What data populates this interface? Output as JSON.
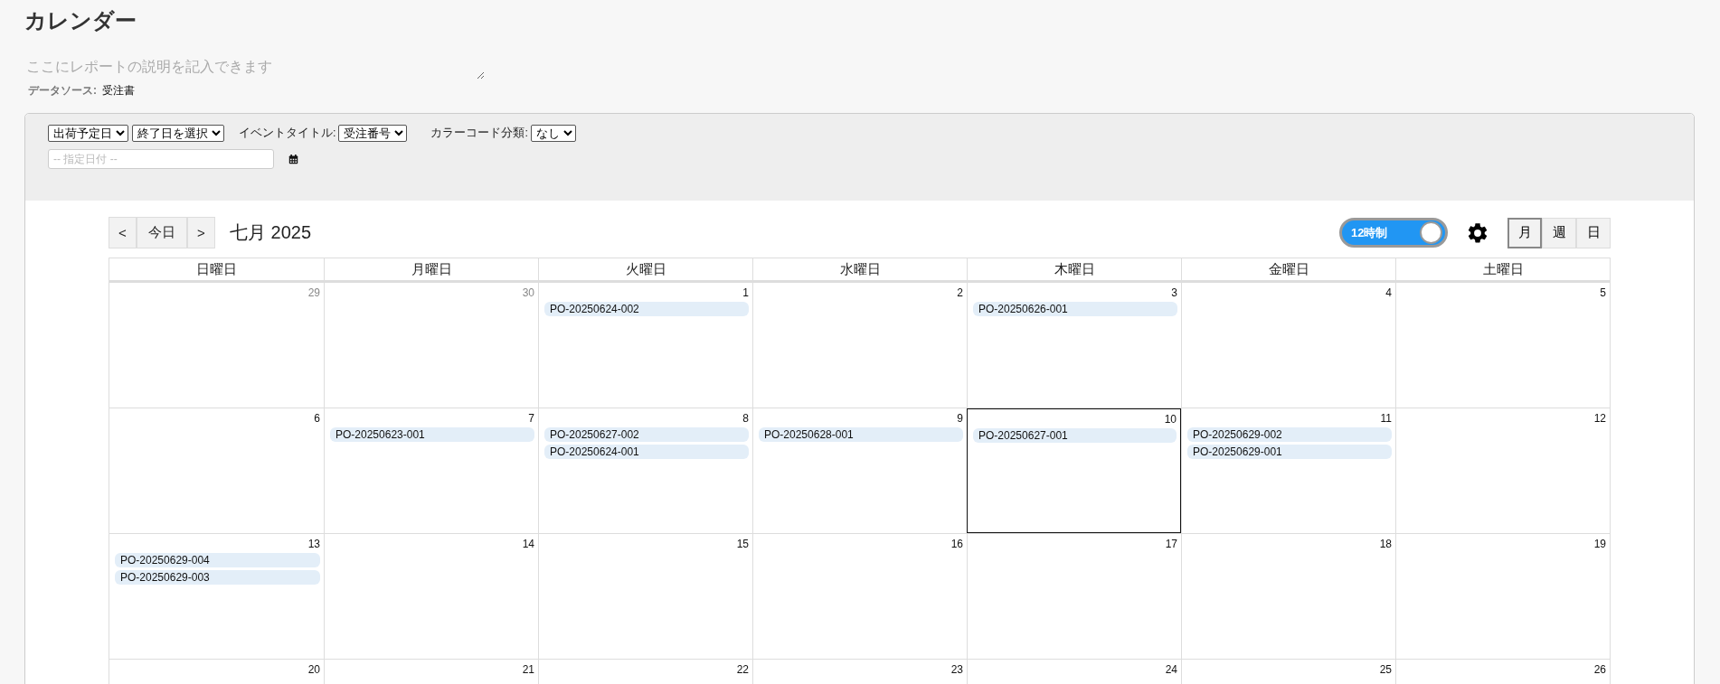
{
  "title": "カレンダー",
  "description": {
    "placeholder": "ここにレポートの説明を記入できます"
  },
  "data_source": {
    "label": "データソース:",
    "value": "受注書"
  },
  "filters": [
    {
      "value": "出荷予定日"
    },
    {
      "value": "終了日を選択"
    },
    {
      "label": "イベントタイトル:",
      "value": "受注番号"
    },
    {
      "label": "カラーコード分類:",
      "value": "なし"
    }
  ],
  "date_field": {
    "placeholder": "-- 指定日付 --"
  },
  "calendar": {
    "prev": "<",
    "today_button": "今日",
    "next": ">",
    "month_label": "七月 2025",
    "toggle": {
      "label": "12時制",
      "on": true
    },
    "views": [
      {
        "label": "月",
        "selected": true
      },
      {
        "label": "週",
        "selected": false
      },
      {
        "label": "日",
        "selected": false
      }
    ],
    "weekdays": [
      "日曜日",
      "月曜日",
      "火曜日",
      "水曜日",
      "木曜日",
      "金曜日",
      "土曜日"
    ],
    "weeks": [
      [
        {
          "day": "29",
          "other_month": true,
          "today": false
        },
        {
          "day": "30",
          "other_month": true,
          "today": false
        },
        {
          "day": "1",
          "other_month": false,
          "today": false,
          "events": [
            "PO-20250624-002"
          ]
        },
        {
          "day": "2",
          "other_month": false,
          "today": false
        },
        {
          "day": "3",
          "other_month": false,
          "today": false,
          "events": [
            "PO-20250626-001"
          ]
        },
        {
          "day": "4",
          "other_month": false,
          "today": false
        },
        {
          "day": "5",
          "other_month": false,
          "today": false
        }
      ],
      [
        {
          "day": "6",
          "other_month": false,
          "today": false
        },
        {
          "day": "7",
          "other_month": false,
          "today": false,
          "events": [
            "PO-20250623-001"
          ]
        },
        {
          "day": "8",
          "other_month": false,
          "today": false,
          "events": [
            "PO-20250627-002",
            "PO-20250624-001"
          ]
        },
        {
          "day": "9",
          "other_month": false,
          "today": false,
          "events": [
            "PO-20250628-001"
          ]
        },
        {
          "day": "10",
          "other_month": false,
          "today": true,
          "events": [
            "PO-20250627-001"
          ]
        },
        {
          "day": "11",
          "other_month": false,
          "today": false,
          "events": [
            "PO-20250629-002",
            "PO-20250629-001"
          ]
        },
        {
          "day": "12",
          "other_month": false,
          "today": false
        }
      ],
      [
        {
          "day": "13",
          "other_month": false,
          "today": false,
          "events": [
            "PO-20250629-004",
            "PO-20250629-003"
          ]
        },
        {
          "day": "14",
          "other_month": false,
          "today": false
        },
        {
          "day": "15",
          "other_month": false,
          "today": false
        },
        {
          "day": "16",
          "other_month": false,
          "today": false
        },
        {
          "day": "17",
          "other_month": false,
          "today": false
        },
        {
          "day": "18",
          "other_month": false,
          "today": false
        },
        {
          "day": "19",
          "other_month": false,
          "today": false
        }
      ],
      [
        {
          "day": "20",
          "other_month": false,
          "today": false
        },
        {
          "day": "21",
          "other_month": false,
          "today": false
        },
        {
          "day": "22",
          "other_month": false,
          "today": false
        },
        {
          "day": "23",
          "other_month": false,
          "today": false
        },
        {
          "day": "24",
          "other_month": false,
          "today": false
        },
        {
          "day": "25",
          "other_month": false,
          "today": false
        },
        {
          "day": "26",
          "other_month": false,
          "today": false
        }
      ]
    ]
  }
}
